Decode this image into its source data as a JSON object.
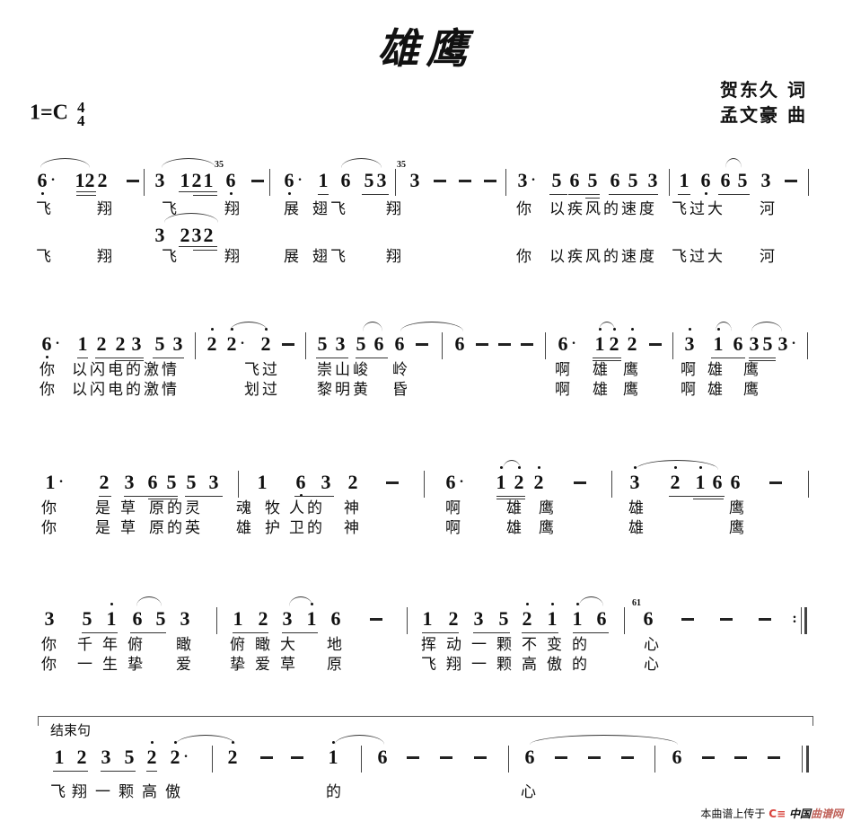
{
  "header": {
    "title": "雄鹰",
    "lyricist": "贺东久 词",
    "composer": "孟文豪 曲",
    "key": "1=C",
    "time_signature": {
      "top": "4",
      "bottom": "4"
    }
  },
  "systems": [
    {
      "notation": "6· 12 2 – | 3 121 6 – | 6· 1 6 53 | (35)3 – – – | 3· 5 6 5 6 5 3 | 1 6 6 5 (35)3 – |",
      "alt_notation": "3 232",
      "lyrics": [
        [
          "飞",
          "翔",
          "飞",
          "翔",
          "展",
          "翅飞",
          "翔",
          "你",
          "以疾风的速度",
          "飞过大",
          "河"
        ],
        [
          "飞",
          "翔",
          "飞",
          "翔",
          "展",
          "翅飞",
          "翔",
          "你",
          "以疾风的速度",
          "飞过大",
          "河"
        ]
      ]
    },
    {
      "notation": "6· 1 2 2 3 5 3 | 2 2· 2 – | 5 3 5 6 6 – | 6 – – – | 6· 1 2 2 – | 3 1 6 3 5 3· |",
      "lyrics": [
        [
          "你",
          "以闪电的激情",
          "飞过",
          "崇山峻",
          "岭",
          "啊",
          "雄",
          "鹰",
          "啊",
          "雄",
          "鹰"
        ],
        [
          "你",
          "以闪电的激情",
          "划过",
          "黎明黄",
          "昏",
          "啊",
          "雄",
          "鹰",
          "啊",
          "雄",
          "鹰"
        ]
      ]
    },
    {
      "notation": "1· 2 3 6 5 5 3 | 1 6 3 2 – | 6· 1 2 2 – | 3 2 1 6 6 – |",
      "lyrics": [
        [
          "你",
          "是",
          "草",
          "原的灵",
          "魂",
          "牧",
          "人的",
          "神",
          "啊",
          "雄",
          "鹰",
          "雄",
          "鹰"
        ],
        [
          "你",
          "是",
          "草",
          "原的英",
          "雄",
          "护",
          "卫的",
          "神",
          "啊",
          "雄",
          "鹰",
          "雄",
          "鹰"
        ]
      ]
    },
    {
      "notation": "3 5 1 6 5 3 | 1 2 3 1 6 – | 1 2 3 5 2 1 1 6 | (61)6 – – – :||",
      "lyrics": [
        [
          "你",
          "千",
          "年",
          "俯",
          "瞰",
          "俯",
          "瞰",
          "大",
          "地",
          "挥",
          "动",
          "一",
          "颗",
          "不",
          "变",
          "的",
          "心"
        ],
        [
          "你",
          "一",
          "生",
          "挚",
          "爱",
          "挚",
          "爱",
          "草",
          "原",
          "飞",
          "翔",
          "一",
          "颗",
          "高",
          "傲",
          "的",
          "心"
        ]
      ]
    },
    {
      "label": "结束句",
      "notation": "1 2 3 5 2 2· | 2 – – 1 | 6 – – – | 6 – – – | 6 – – – ||",
      "lyrics": [
        [
          "飞",
          "翔",
          "一",
          "颗",
          "高",
          "傲",
          "的",
          "心"
        ]
      ]
    }
  ],
  "footer": {
    "upload_text": "本曲谱上传于",
    "site_name_a": "中国",
    "site_name_b": "曲谱网",
    "logo_glyph": "C≡"
  },
  "colors": {
    "ink": "#111111",
    "logo_red": "#d8413a",
    "logo_brown": "#c0625a"
  }
}
